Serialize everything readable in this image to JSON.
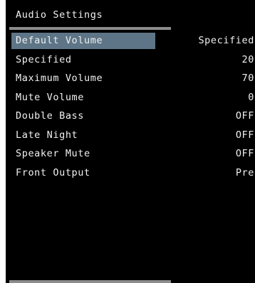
{
  "window": {
    "title": "Audio Settings"
  },
  "menu": {
    "selected_index": 0,
    "items": [
      {
        "label": "Default Volume",
        "value": "Specified"
      },
      {
        "label": "Specified",
        "value": "20"
      },
      {
        "label": "Maximum Volume",
        "value": "70"
      },
      {
        "label": "Mute Volume",
        "value": "0"
      },
      {
        "label": "Double Bass",
        "value": "OFF"
      },
      {
        "label": "Late Night",
        "value": "OFF"
      },
      {
        "label": "Speaker Mute",
        "value": "OFF"
      },
      {
        "label": "Front Output",
        "value": "Pre"
      }
    ]
  },
  "colors": {
    "background": "#000000",
    "text": "#f0f0f0",
    "selection": "#5d7586",
    "rule": "#8c8c8c"
  }
}
